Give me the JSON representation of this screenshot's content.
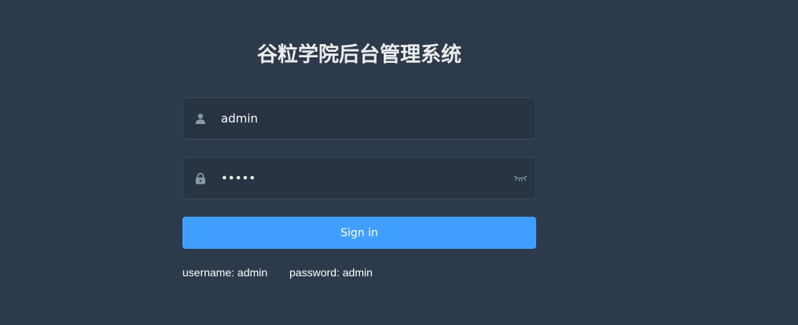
{
  "login": {
    "title": "谷粒学院后台管理系统",
    "username": {
      "value": "admin",
      "icon": "user-icon"
    },
    "password": {
      "value": "•••••",
      "icon": "lock-icon",
      "toggle_icon": "eye-closed-icon"
    },
    "sign_in_label": "Sign in",
    "tips": {
      "username": "username: admin",
      "password": "password: admin"
    }
  },
  "colors": {
    "background": "#2d3a4b",
    "button": "#409eff",
    "title": "#eeeeee",
    "icon": "#889aa4"
  }
}
